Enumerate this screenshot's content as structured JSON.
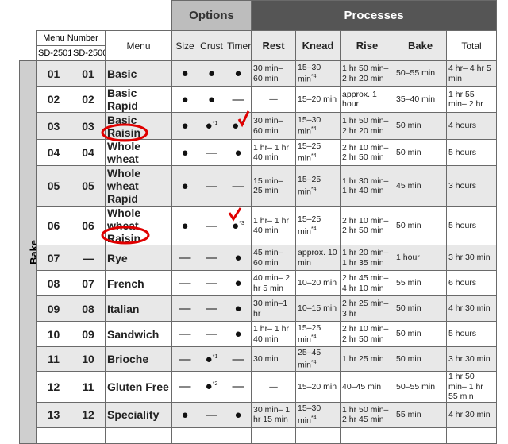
{
  "header": {
    "options": "Options",
    "processes": "Processes",
    "menu_number": "Menu Number",
    "sd2501": "SD-2501",
    "sd2500": "SD-2500",
    "menu": "Menu",
    "size": "Size",
    "crust": "Crust",
    "timer": "Timer",
    "rest": "Rest",
    "knead": "Knead",
    "rise": "Rise",
    "bake": "Bake",
    "total": "Total"
  },
  "section_label": "Bake",
  "colors": {
    "options_bg": "#bdbdbd",
    "processes_bg": "#555555",
    "annotation": "#e00000"
  },
  "rows": [
    {
      "a": "01",
      "b": "01",
      "menu": "Basic",
      "size": "●",
      "crust": "●",
      "timer": "●",
      "rest": "30 min– 60 min",
      "knead": "15–30 min",
      "knead_sup": "*4",
      "rise": "1 hr 50 min– 2 hr 20 min",
      "bake": "50–55 min",
      "total": "4 hr– 4 hr 5 min"
    },
    {
      "a": "02",
      "b": "02",
      "menu": "Basic Rapid",
      "size": "●",
      "crust": "●",
      "timer": "—",
      "rest": "—",
      "knead": "15–20 min",
      "rise": "approx. 1 hour",
      "bake": "35–40 min",
      "total": "1 hr 55 min– 2 hr"
    },
    {
      "a": "03",
      "b": "03",
      "menu": "Basic Raisin",
      "size": "●",
      "crust": "●",
      "crust_sup": "*1",
      "timer": "●",
      "timer_sup": "*3",
      "rest": "30 min– 60 min",
      "knead": "15–30 min",
      "knead_sup": "*4",
      "rise": "1 hr 50 min– 2 hr 20 min",
      "bake": "50 min",
      "total": "4 hours"
    },
    {
      "a": "04",
      "b": "04",
      "menu": "Whole wheat",
      "size": "●",
      "crust": "—",
      "timer": "●",
      "rest": "1 hr– 1 hr 40 min",
      "knead": "15–25 min",
      "knead_sup": "*4",
      "rise": "2 hr 10 min– 2 hr 50 min",
      "bake": "50 min",
      "total": "5 hours"
    },
    {
      "a": "05",
      "b": "05",
      "menu": "Whole wheat Rapid",
      "size": "●",
      "crust": "—",
      "timer": "—",
      "rest": "15 min– 25 min",
      "knead": "15–25 min",
      "knead_sup": "*4",
      "rise": "1 hr 30 min– 1 hr 40 min",
      "bake": "45 min",
      "total": "3 hours"
    },
    {
      "a": "06",
      "b": "06",
      "menu": "Whole wheat Raisin",
      "size": "●",
      "crust": "—",
      "timer": "●",
      "timer_sup": "*3",
      "rest": "1 hr– 1 hr 40 min",
      "knead": "15–25 min",
      "knead_sup": "*4",
      "rise": "2 hr 10 min– 2 hr 50 min",
      "bake": "50 min",
      "total": "5 hours"
    },
    {
      "a": "07",
      "b": "—",
      "menu": "Rye",
      "size": "—",
      "crust": "—",
      "timer": "●",
      "rest": "45 min– 60 min",
      "knead": "approx. 10 min",
      "rise": "1 hr 20 min– 1 hr 35 min",
      "bake": "1 hour",
      "total": "3 hr 30 min"
    },
    {
      "a": "08",
      "b": "07",
      "menu": "French",
      "size": "—",
      "crust": "—",
      "timer": "●",
      "rest": "40 min– 2 hr 5 min",
      "knead": "10–20 min",
      "rise": "2 hr 45 min– 4 hr 10 min",
      "bake": "55 min",
      "total": "6 hours"
    },
    {
      "a": "09",
      "b": "08",
      "menu": "Italian",
      "size": "—",
      "crust": "—",
      "timer": "●",
      "rest": "30 min–1 hr",
      "knead": "10–15 min",
      "rise": "2 hr 25 min– 3 hr",
      "bake": "50 min",
      "total": "4 hr 30 min"
    },
    {
      "a": "10",
      "b": "09",
      "menu": "Sandwich",
      "size": "—",
      "crust": "—",
      "timer": "●",
      "rest": "1 hr– 1 hr 40 min",
      "knead": "15–25 min",
      "knead_sup": "*4",
      "rise": "2 hr 10 min– 2 hr 50 min",
      "bake": "50 min",
      "total": "5 hours"
    },
    {
      "a": "11",
      "b": "10",
      "menu": "Brioche",
      "size": "—",
      "crust": "●",
      "crust_sup": "*1",
      "timer": "—",
      "rest": "30 min",
      "knead": "25–45 min",
      "knead_sup": "*4",
      "rise": "1 hr 25 min",
      "bake": "50 min",
      "total": "3 hr 30 min"
    },
    {
      "a": "12",
      "b": "11",
      "menu": "Gluten Free",
      "size": "—",
      "crust": "●",
      "crust_sup": "*2",
      "timer": "—",
      "rest": "—",
      "knead": "15–20 min",
      "rise": "40–45 min",
      "bake": "50–55 min",
      "total": "1 hr 50 min– 1 hr 55 min"
    },
    {
      "a": "13",
      "b": "12",
      "menu": "Speciality",
      "size": "●",
      "crust": "—",
      "timer": "●",
      "rest": "30 min– 1 hr 15 min",
      "knead": "15–30 min",
      "knead_sup": "*4",
      "rise": "1 hr 50 min– 2 hr 45 min",
      "bake": "55 min",
      "total": "4 hr 30 min"
    }
  ]
}
